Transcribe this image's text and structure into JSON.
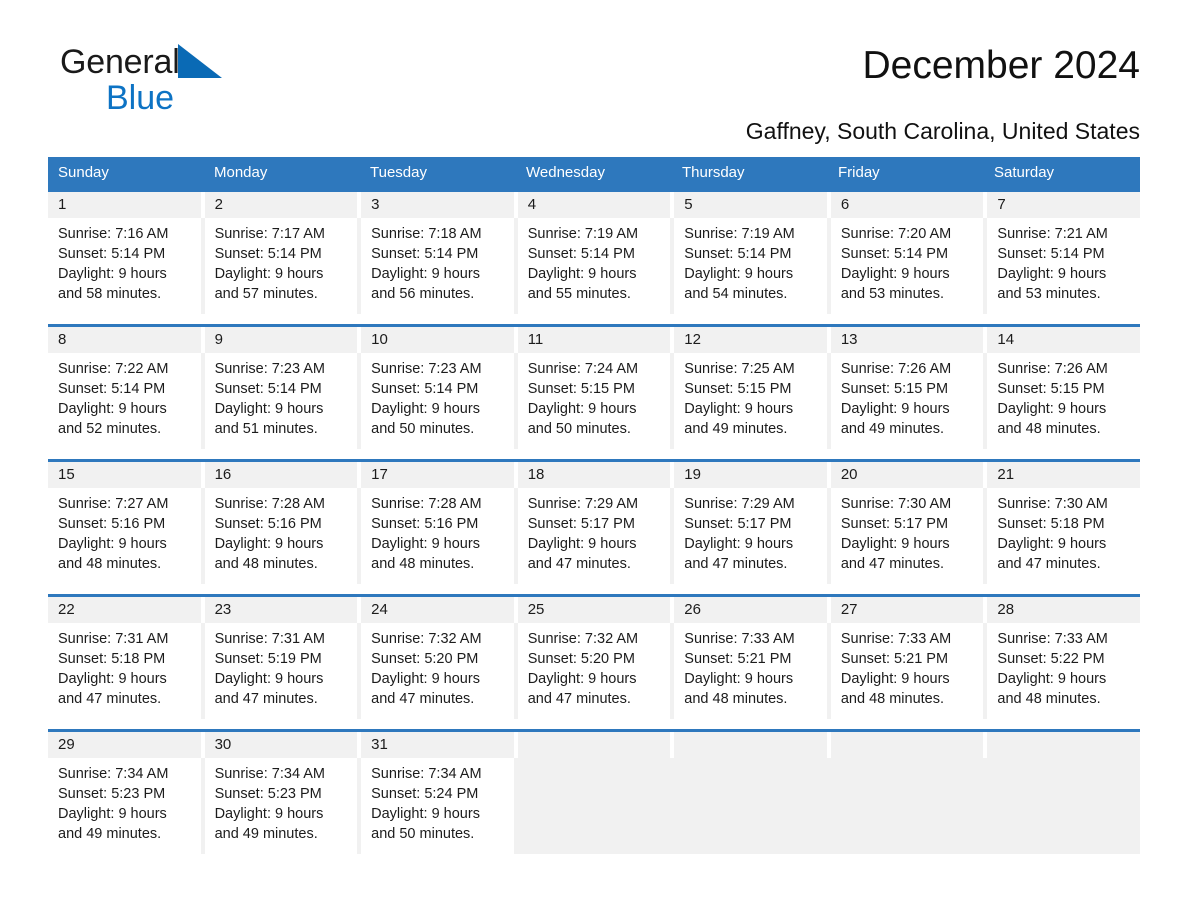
{
  "brand": {
    "name_part1": "General",
    "name_part2": "Blue",
    "triangle_color": "#0a6ab5",
    "blue_color": "#0d73c4"
  },
  "header": {
    "title": "December 2024",
    "subtitle": "Gaffney, South Carolina, United States"
  },
  "theme": {
    "header_band": "#2e78bd",
    "row_divider": "#2e78bd",
    "daynum_band": "#f1f1f1",
    "text": "#1c1c1c"
  },
  "weekdays": [
    "Sunday",
    "Monday",
    "Tuesday",
    "Wednesday",
    "Thursday",
    "Friday",
    "Saturday"
  ],
  "labels": {
    "sunrise_prefix": "Sunrise:",
    "sunset_prefix": "Sunset:",
    "daylight_prefix": "Daylight:"
  },
  "weeks": [
    [
      {
        "day": "1",
        "sunrise": "Sunrise: 7:16 AM",
        "sunset": "Sunset: 5:14 PM",
        "daylight_line1": "Daylight: 9 hours",
        "daylight_line2": "and 58 minutes."
      },
      {
        "day": "2",
        "sunrise": "Sunrise: 7:17 AM",
        "sunset": "Sunset: 5:14 PM",
        "daylight_line1": "Daylight: 9 hours",
        "daylight_line2": "and 57 minutes."
      },
      {
        "day": "3",
        "sunrise": "Sunrise: 7:18 AM",
        "sunset": "Sunset: 5:14 PM",
        "daylight_line1": "Daylight: 9 hours",
        "daylight_line2": "and 56 minutes."
      },
      {
        "day": "4",
        "sunrise": "Sunrise: 7:19 AM",
        "sunset": "Sunset: 5:14 PM",
        "daylight_line1": "Daylight: 9 hours",
        "daylight_line2": "and 55 minutes."
      },
      {
        "day": "5",
        "sunrise": "Sunrise: 7:19 AM",
        "sunset": "Sunset: 5:14 PM",
        "daylight_line1": "Daylight: 9 hours",
        "daylight_line2": "and 54 minutes."
      },
      {
        "day": "6",
        "sunrise": "Sunrise: 7:20 AM",
        "sunset": "Sunset: 5:14 PM",
        "daylight_line1": "Daylight: 9 hours",
        "daylight_line2": "and 53 minutes."
      },
      {
        "day": "7",
        "sunrise": "Sunrise: 7:21 AM",
        "sunset": "Sunset: 5:14 PM",
        "daylight_line1": "Daylight: 9 hours",
        "daylight_line2": "and 53 minutes."
      }
    ],
    [
      {
        "day": "8",
        "sunrise": "Sunrise: 7:22 AM",
        "sunset": "Sunset: 5:14 PM",
        "daylight_line1": "Daylight: 9 hours",
        "daylight_line2": "and 52 minutes."
      },
      {
        "day": "9",
        "sunrise": "Sunrise: 7:23 AM",
        "sunset": "Sunset: 5:14 PM",
        "daylight_line1": "Daylight: 9 hours",
        "daylight_line2": "and 51 minutes."
      },
      {
        "day": "10",
        "sunrise": "Sunrise: 7:23 AM",
        "sunset": "Sunset: 5:14 PM",
        "daylight_line1": "Daylight: 9 hours",
        "daylight_line2": "and 50 minutes."
      },
      {
        "day": "11",
        "sunrise": "Sunrise: 7:24 AM",
        "sunset": "Sunset: 5:15 PM",
        "daylight_line1": "Daylight: 9 hours",
        "daylight_line2": "and 50 minutes."
      },
      {
        "day": "12",
        "sunrise": "Sunrise: 7:25 AM",
        "sunset": "Sunset: 5:15 PM",
        "daylight_line1": "Daylight: 9 hours",
        "daylight_line2": "and 49 minutes."
      },
      {
        "day": "13",
        "sunrise": "Sunrise: 7:26 AM",
        "sunset": "Sunset: 5:15 PM",
        "daylight_line1": "Daylight: 9 hours",
        "daylight_line2": "and 49 minutes."
      },
      {
        "day": "14",
        "sunrise": "Sunrise: 7:26 AM",
        "sunset": "Sunset: 5:15 PM",
        "daylight_line1": "Daylight: 9 hours",
        "daylight_line2": "and 48 minutes."
      }
    ],
    [
      {
        "day": "15",
        "sunrise": "Sunrise: 7:27 AM",
        "sunset": "Sunset: 5:16 PM",
        "daylight_line1": "Daylight: 9 hours",
        "daylight_line2": "and 48 minutes."
      },
      {
        "day": "16",
        "sunrise": "Sunrise: 7:28 AM",
        "sunset": "Sunset: 5:16 PM",
        "daylight_line1": "Daylight: 9 hours",
        "daylight_line2": "and 48 minutes."
      },
      {
        "day": "17",
        "sunrise": "Sunrise: 7:28 AM",
        "sunset": "Sunset: 5:16 PM",
        "daylight_line1": "Daylight: 9 hours",
        "daylight_line2": "and 48 minutes."
      },
      {
        "day": "18",
        "sunrise": "Sunrise: 7:29 AM",
        "sunset": "Sunset: 5:17 PM",
        "daylight_line1": "Daylight: 9 hours",
        "daylight_line2": "and 47 minutes."
      },
      {
        "day": "19",
        "sunrise": "Sunrise: 7:29 AM",
        "sunset": "Sunset: 5:17 PM",
        "daylight_line1": "Daylight: 9 hours",
        "daylight_line2": "and 47 minutes."
      },
      {
        "day": "20",
        "sunrise": "Sunrise: 7:30 AM",
        "sunset": "Sunset: 5:17 PM",
        "daylight_line1": "Daylight: 9 hours",
        "daylight_line2": "and 47 minutes."
      },
      {
        "day": "21",
        "sunrise": "Sunrise: 7:30 AM",
        "sunset": "Sunset: 5:18 PM",
        "daylight_line1": "Daylight: 9 hours",
        "daylight_line2": "and 47 minutes."
      }
    ],
    [
      {
        "day": "22",
        "sunrise": "Sunrise: 7:31 AM",
        "sunset": "Sunset: 5:18 PM",
        "daylight_line1": "Daylight: 9 hours",
        "daylight_line2": "and 47 minutes."
      },
      {
        "day": "23",
        "sunrise": "Sunrise: 7:31 AM",
        "sunset": "Sunset: 5:19 PM",
        "daylight_line1": "Daylight: 9 hours",
        "daylight_line2": "and 47 minutes."
      },
      {
        "day": "24",
        "sunrise": "Sunrise: 7:32 AM",
        "sunset": "Sunset: 5:20 PM",
        "daylight_line1": "Daylight: 9 hours",
        "daylight_line2": "and 47 minutes."
      },
      {
        "day": "25",
        "sunrise": "Sunrise: 7:32 AM",
        "sunset": "Sunset: 5:20 PM",
        "daylight_line1": "Daylight: 9 hours",
        "daylight_line2": "and 47 minutes."
      },
      {
        "day": "26",
        "sunrise": "Sunrise: 7:33 AM",
        "sunset": "Sunset: 5:21 PM",
        "daylight_line1": "Daylight: 9 hours",
        "daylight_line2": "and 48 minutes."
      },
      {
        "day": "27",
        "sunrise": "Sunrise: 7:33 AM",
        "sunset": "Sunset: 5:21 PM",
        "daylight_line1": "Daylight: 9 hours",
        "daylight_line2": "and 48 minutes."
      },
      {
        "day": "28",
        "sunrise": "Sunrise: 7:33 AM",
        "sunset": "Sunset: 5:22 PM",
        "daylight_line1": "Daylight: 9 hours",
        "daylight_line2": "and 48 minutes."
      }
    ],
    [
      {
        "day": "29",
        "sunrise": "Sunrise: 7:34 AM",
        "sunset": "Sunset: 5:23 PM",
        "daylight_line1": "Daylight: 9 hours",
        "daylight_line2": "and 49 minutes."
      },
      {
        "day": "30",
        "sunrise": "Sunrise: 7:34 AM",
        "sunset": "Sunset: 5:23 PM",
        "daylight_line1": "Daylight: 9 hours",
        "daylight_line2": "and 49 minutes."
      },
      {
        "day": "31",
        "sunrise": "Sunrise: 7:34 AM",
        "sunset": "Sunset: 5:24 PM",
        "daylight_line1": "Daylight: 9 hours",
        "daylight_line2": "and 50 minutes."
      },
      {
        "day": "",
        "sunrise": "",
        "sunset": "",
        "daylight_line1": "",
        "daylight_line2": ""
      },
      {
        "day": "",
        "sunrise": "",
        "sunset": "",
        "daylight_line1": "",
        "daylight_line2": ""
      },
      {
        "day": "",
        "sunrise": "",
        "sunset": "",
        "daylight_line1": "",
        "daylight_line2": ""
      },
      {
        "day": "",
        "sunrise": "",
        "sunset": "",
        "daylight_line1": "",
        "daylight_line2": ""
      }
    ]
  ]
}
